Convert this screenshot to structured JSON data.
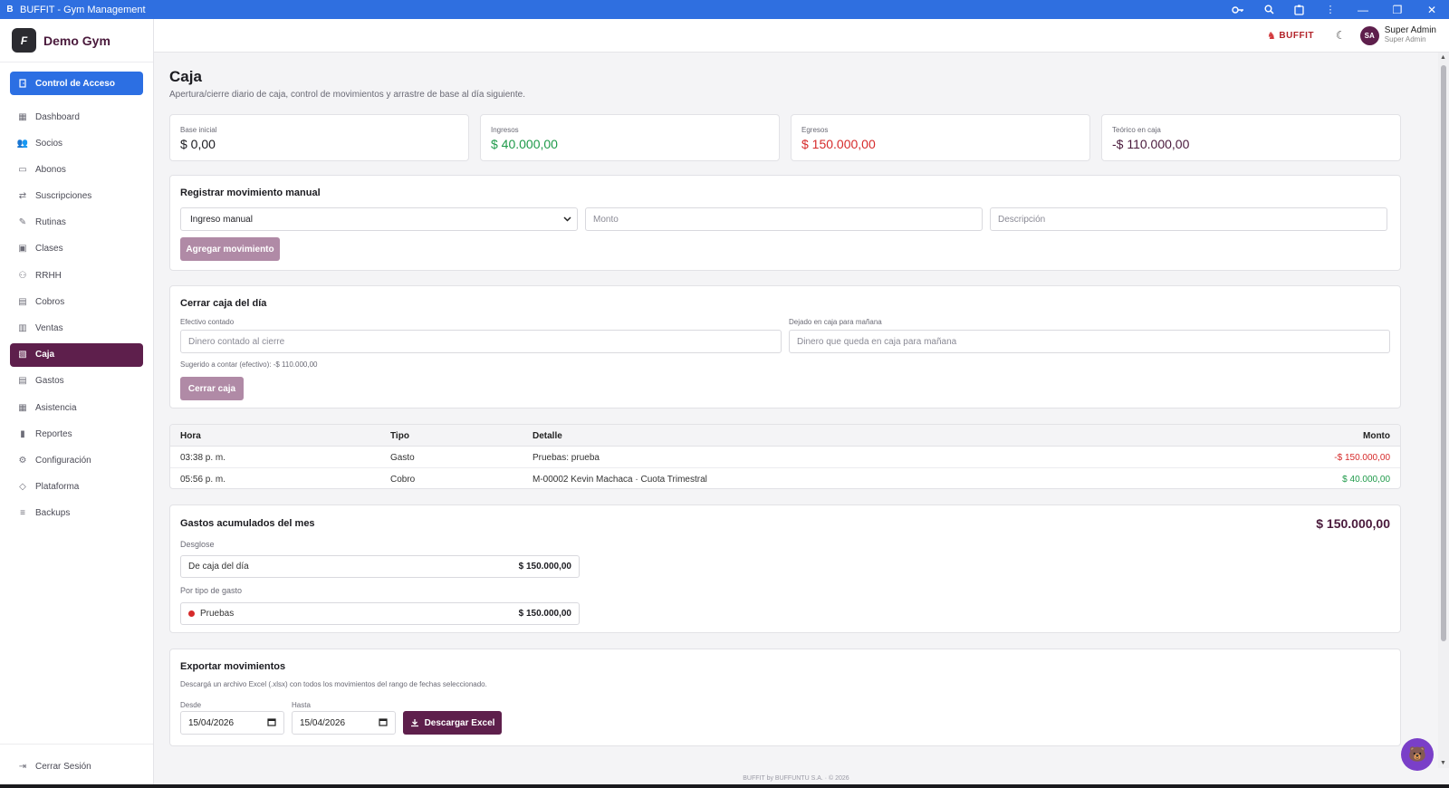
{
  "window": {
    "app_glyph": "B",
    "title": "BUFFIT - Gym Management",
    "icons": [
      "key-icon",
      "zoom-icon",
      "extensions-icon",
      "more-icon"
    ],
    "controls": {
      "minimize": "—",
      "restore": "❐",
      "close": "✕"
    }
  },
  "brand": {
    "logo_glyph": "F",
    "name": "Demo Gym"
  },
  "sidebar": {
    "primary": {
      "label": "Control de Acceso",
      "icon": "door-icon"
    },
    "items": [
      {
        "label": "Dashboard",
        "icon": "grid-icon",
        "glyph": "▦"
      },
      {
        "label": "Socios",
        "icon": "users-icon",
        "glyph": "👥"
      },
      {
        "label": "Abonos",
        "icon": "card-icon",
        "glyph": "▭"
      },
      {
        "label": "Suscripciones",
        "icon": "repeat-icon",
        "glyph": "⇄"
      },
      {
        "label": "Rutinas",
        "icon": "dumbbell-icon",
        "glyph": "✎"
      },
      {
        "label": "Clases",
        "icon": "calendar-icon",
        "glyph": "▣"
      },
      {
        "label": "RRHH",
        "icon": "staff-icon",
        "glyph": "⚇"
      },
      {
        "label": "Cobros",
        "icon": "clipboard-icon",
        "glyph": "▤"
      },
      {
        "label": "Ventas",
        "icon": "receipt-icon",
        "glyph": "▥"
      },
      {
        "label": "Caja",
        "icon": "cashbox-icon",
        "glyph": "▧"
      },
      {
        "label": "Gastos",
        "icon": "expense-icon",
        "glyph": "▤"
      },
      {
        "label": "Asistencia",
        "icon": "attendance-icon",
        "glyph": "▦"
      },
      {
        "label": "Reportes",
        "icon": "chart-icon",
        "glyph": "▮"
      },
      {
        "label": "Configuración",
        "icon": "gear-icon",
        "glyph": "⚙"
      },
      {
        "label": "Plataforma",
        "icon": "shield-icon",
        "glyph": "◇"
      },
      {
        "label": "Backups",
        "icon": "database-icon",
        "glyph": "≡"
      }
    ],
    "active": "Caja",
    "logout": "Cerrar Sesión"
  },
  "header": {
    "logo_text": "BUFFIT",
    "user": {
      "initials": "SA",
      "name": "Super Admin",
      "role": "Super Admin"
    }
  },
  "page": {
    "title": "Caja",
    "subtitle": "Apertura/cierre diario de caja, control de movimientos y arrastre de base al día siguiente."
  },
  "stats": [
    {
      "label": "Base inicial",
      "value": "$ 0,00"
    },
    {
      "label": "Ingresos",
      "value": "$ 40.000,00"
    },
    {
      "label": "Egresos",
      "value": "$ 150.000,00"
    },
    {
      "label": "Teórico en caja",
      "value": "-$ 110.000,00"
    }
  ],
  "manual": {
    "title": "Registrar movimiento manual",
    "type_value": "Ingreso manual",
    "amount_placeholder": "Monto",
    "description_placeholder": "Descripción",
    "button": "Agregar movimiento"
  },
  "close_day": {
    "title": "Cerrar caja del día",
    "counted_label": "Efectivo contado",
    "counted_placeholder": "Dinero contado al cierre",
    "left_label": "Dejado en caja para mañana",
    "left_placeholder": "Dinero que queda en caja para mañana",
    "suggested": "Sugerido a contar (efectivo): -$ 110.000,00",
    "button": "Cerrar caja"
  },
  "movements": {
    "headers": {
      "hora": "Hora",
      "tipo": "Tipo",
      "detalle": "Detalle",
      "monto": "Monto"
    },
    "rows": [
      {
        "hora": "03:38 p. m.",
        "tipo": "Gasto",
        "detalle": "Pruebas: prueba",
        "monto": "-$ 150.000,00"
      },
      {
        "hora": "05:56 p. m.",
        "tipo": "Cobro",
        "detalle": "M-00002 Kevin Machaca · Cuota Trimestral",
        "monto": "$ 40.000,00"
      }
    ]
  },
  "expenses": {
    "title": "Gastos acumulados del mes",
    "total": "$ 150.000,00",
    "breakdown_label": "Desglose",
    "breakdown": [
      {
        "label": "De caja del día",
        "value": "$ 150.000,00"
      }
    ],
    "by_type_label": "Por tipo de gasto",
    "by_type": [
      {
        "label": "Pruebas",
        "value": "$ 150.000,00",
        "color": "#d62a2a"
      }
    ]
  },
  "export": {
    "title": "Exportar movimientos",
    "description": "Descargá un archivo Excel (.xlsx) con todos los movimientos del rango de fechas seleccionado.",
    "from_label": "Desde",
    "from_value": "15/04/2026",
    "to_label": "Hasta",
    "to_value": "15/04/2026",
    "button": "Descargar Excel"
  },
  "footer": "BUFFIT by BUFFUNTU S.A. · © 2026",
  "colors": {
    "accent": "#5e1f4c",
    "primary_blue": "#2c6fe3",
    "positive": "#1f9a4a",
    "negative": "#d62a2a"
  }
}
